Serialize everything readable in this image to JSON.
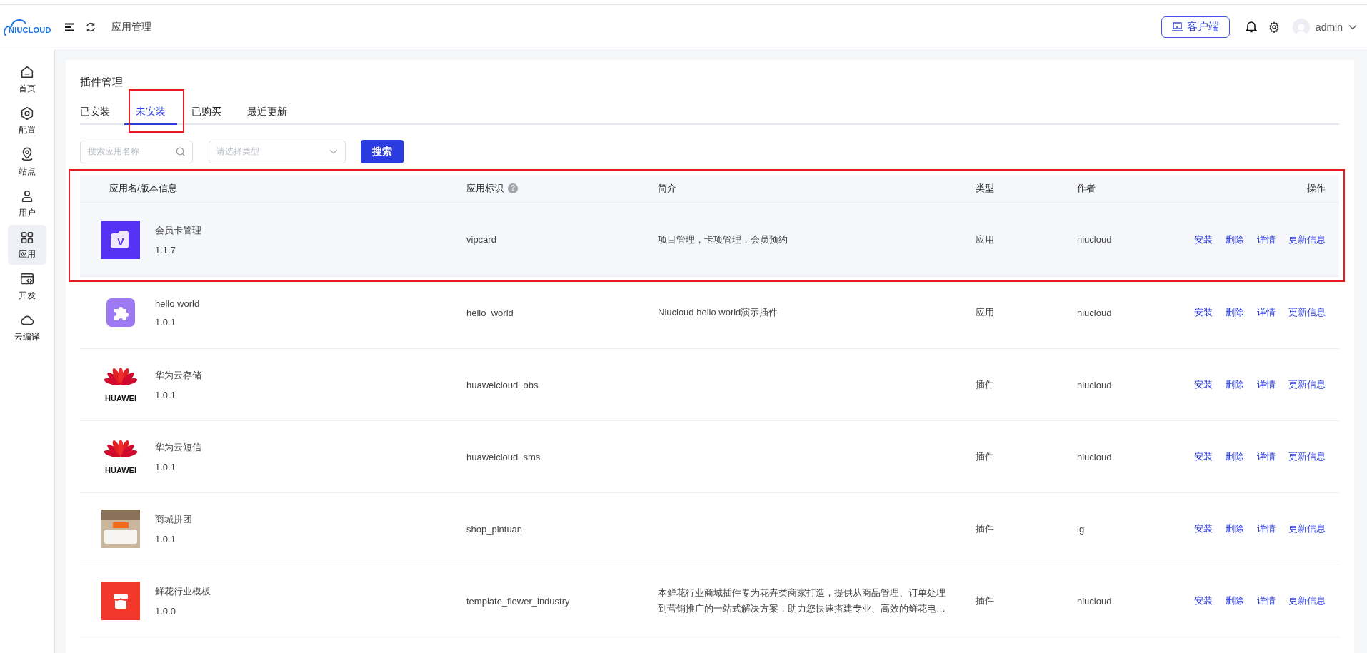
{
  "topbar": {
    "logo_text": "NIUCLOUD",
    "breadcrumb": "应用管理",
    "client_button": "客户端",
    "username": "admin"
  },
  "sidebar": {
    "items": [
      {
        "label": "首页",
        "kind": "home",
        "selected": false
      },
      {
        "label": "配置",
        "kind": "hexagon",
        "selected": false
      },
      {
        "label": "站点",
        "kind": "pin",
        "selected": false
      },
      {
        "label": "用户",
        "kind": "user",
        "selected": false
      },
      {
        "label": "应用",
        "kind": "grid",
        "selected": true
      },
      {
        "label": "开发",
        "kind": "code",
        "selected": false
      },
      {
        "label": "云编译",
        "kind": "cloud",
        "selected": false
      }
    ]
  },
  "page": {
    "title": "插件管理"
  },
  "tabs": [
    {
      "label": "已安装",
      "selected": false,
      "highlighted": false
    },
    {
      "label": "未安装",
      "selected": true,
      "highlighted": true
    },
    {
      "label": "已购买",
      "selected": false,
      "highlighted": false
    },
    {
      "label": "最近更新",
      "selected": false,
      "highlighted": false
    }
  ],
  "filters": {
    "search": {
      "placeholder": "搜索应用名称"
    },
    "type_select": {
      "placeholder": "请选择类型"
    },
    "search_button": "搜索"
  },
  "table": {
    "columns": [
      {
        "label": "应用名/版本信息"
      },
      {
        "label": "应用标识",
        "help_icon": "?"
      },
      {
        "label": "简介"
      },
      {
        "label": "类型"
      },
      {
        "label": "作者"
      },
      {
        "label": "操作"
      }
    ],
    "rows": [
      {
        "kind": "vip",
        "logo_text": "V",
        "name": "会员卡管理",
        "version": "1.1.7",
        "key": "vipcard",
        "description": "项目管理，卡项管理，会员预约",
        "type": "应用",
        "author": "niucloud",
        "actions": [
          "安装",
          "删除",
          "详情",
          "更新信息"
        ],
        "hovered": true,
        "highlighted": true
      },
      {
        "kind": "puzzle",
        "name": "hello world",
        "version": "1.0.1",
        "key": "hello_world",
        "description": "Niucloud hello world演示插件",
        "type": "应用",
        "author": "niucloud",
        "actions": [
          "安装",
          "删除",
          "详情",
          "更新信息"
        ],
        "hovered": false,
        "highlighted": false
      },
      {
        "kind": "huawei",
        "logo_text": "HUAWEI",
        "name": "华为云存储",
        "version": "1.0.1",
        "key": "huaweicloud_obs",
        "type": "插件",
        "author": "niucloud",
        "actions": [
          "安装",
          "删除",
          "详情",
          "更新信息"
        ],
        "hovered": false,
        "highlighted": false
      },
      {
        "kind": "huawei",
        "logo_text": "HUAWEI",
        "name": "华为云短信",
        "version": "1.0.1",
        "key": "huaweicloud_sms",
        "type": "插件",
        "author": "niucloud",
        "actions": [
          "安装",
          "删除",
          "详情",
          "更新信息"
        ],
        "hovered": false,
        "highlighted": false
      },
      {
        "kind": "photo",
        "name": "商城拼团",
        "version": "1.0.1",
        "key": "shop_pintuan",
        "type": "插件",
        "author": "lg",
        "actions": [
          "安装",
          "删除",
          "详情",
          "更新信息"
        ],
        "hovered": false,
        "highlighted": false
      },
      {
        "kind": "shop",
        "name": "鲜花行业模板",
        "version": "1.0.0",
        "key": "template_flower_industry",
        "description": "本鲜花行业商城插件专为花卉类商家打造，提供从商品管理、订单处理到营销推广的一站式解决方案，助力您快速搭建专业、高效的鲜花电…",
        "type": "插件",
        "author": "niucloud",
        "actions": [
          "安装",
          "删除",
          "详情",
          "更新信息"
        ],
        "hovered": false,
        "highlighted": false
      }
    ]
  }
}
